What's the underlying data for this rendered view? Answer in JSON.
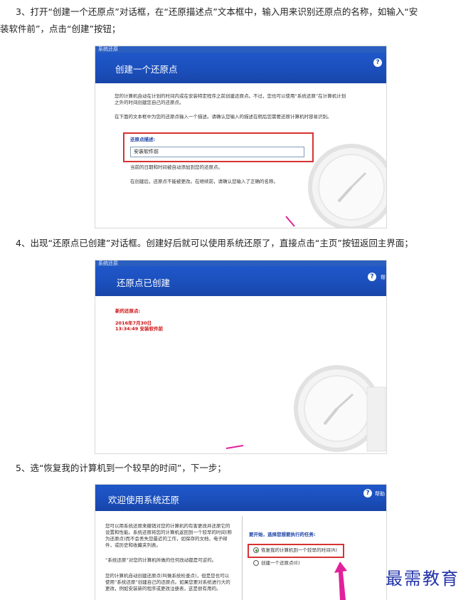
{
  "steps": {
    "step3_line1": "3、打开“创建一个还原点”对话框，在“还原描述点”文本框中，输入用来识别还原点的名称，如输入“安",
    "step3_line2": "装软件前”，点击“创建”按钮；",
    "step4": "4、出现“还原点已创建”对话框。创建好后就可以使用系统还原了，直接点击“主页”按钮返回主界面；",
    "step5": "5、选“恢复我的计算机到一个较早的时间”，下一步；"
  },
  "shot1": {
    "window_title": "系统还原",
    "heading": "创建一个还原点",
    "intro": "您的计算机自动在计划的时间内或在安装特定程序之前创建还原点。不过，您也可以使用“系统还原”在计算机计划之外的时间创建您自己的还原点。",
    "instruction": "在下面的文本框中为您的还原点输入一个描述。请确认您输入的描述在稍后您需要还原计算机时容易识别。",
    "field_label": "还原点描述:",
    "field_value": "安装软件前",
    "note1": "当前的日期和时间被自动添加到您的还原点。",
    "note2": "在创建后，还原点不能被更改。在继续前，请确认您输入了正确的名称。"
  },
  "shot2": {
    "window_title": "系统还原",
    "heading": "还原点已创建",
    "help_label": "帮",
    "new_point_label": "新的还原点:",
    "date": "2016年7月30日",
    "time_desc": "13:34:49  安装软件前"
  },
  "shot3": {
    "heading": "欢迎使用系统还原",
    "help_label": "帮助",
    "left_text1": "您可以用系统还原来撤销对您的计算机的有害更改并还原它的设置和性能。系统还原将您的计算机返回到一个较早的时间(称为还原点)而不会丢失您最近的工作，如保存的文档，电子邮件，或历史和收藏夹列表。",
    "left_text2": "“系统还原”对您的计算机所做的任何改动都是可逆的。",
    "left_text3": "您的计算机自动创建还原点(叫做系统检查点)，但是您也可以使用“系统还原”创建自己的还原点。如果您要对系统进行大的更改，例如安装新的程序或更改注册表，这是很有用的。",
    "task_prompt": "要开始，选择您想要执行的任务:",
    "option1": "恢复我的计算机到一个较早的时间(R)",
    "option2": "创建一个还原点(E)"
  },
  "watermark": "最需教育",
  "colors": {
    "banner": "#1b4fbc",
    "highlight": "#d63333",
    "arrow": "#e0229a",
    "watermark": "#2233aa"
  },
  "icons": [
    "help-icon",
    "clock-icon",
    "radio-icon",
    "arrow-icon"
  ]
}
